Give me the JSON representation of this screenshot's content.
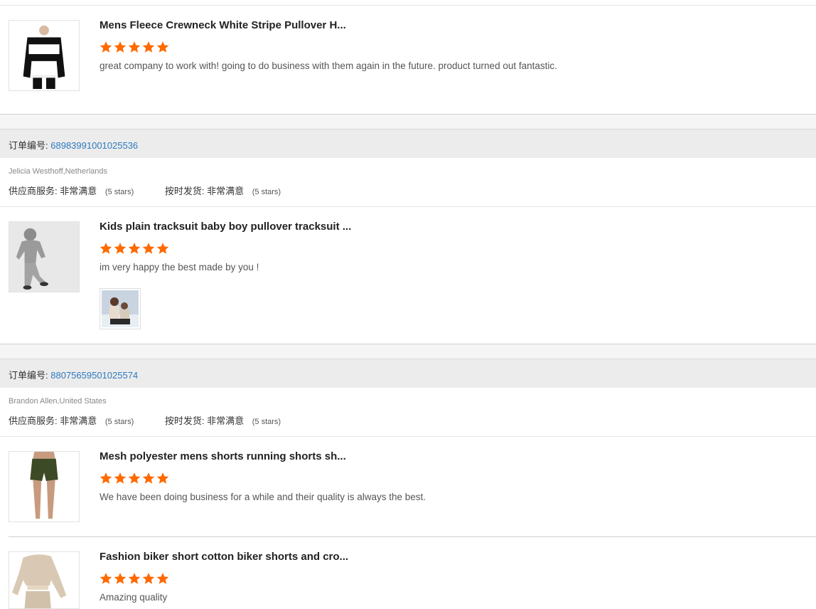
{
  "colors": {
    "accent_link": "#2e7bbf",
    "star": "#ff6a00",
    "order_bar_bg": "#ececec"
  },
  "orders": [
    {
      "items": [
        {
          "thumb_icon": "black-sweater-image",
          "title": "Mens Fleece Crewneck White Stripe Pullover H...",
          "stars": 5,
          "review": "great company to work with! going to do business with them again in the future. product turned out fantastic."
        }
      ]
    },
    {
      "order_label": "订单编号:",
      "order_number": "68983991001025536",
      "buyer": "Jelicia Westhoff,Netherlands",
      "supplier_service_label": "供应商服务:",
      "supplier_service_value": "非常满意",
      "supplier_service_stars": "(5 stars)",
      "delivery_label": "按时发货:",
      "delivery_value": "非常满意",
      "delivery_stars": "(5 stars)",
      "items": [
        {
          "thumb_icon": "kids-tracksuit-image",
          "title": "Kids plain tracksuit baby boy pullover tracksuit ...",
          "stars": 5,
          "review": "im very happy the best made by you !",
          "attachment_icon": "customer-photo-thumbnail"
        }
      ]
    },
    {
      "order_label": "订单编号:",
      "order_number": "88075659501025574",
      "buyer": "Brandon Allen,United States",
      "supplier_service_label": "供应商服务:",
      "supplier_service_value": "非常满意",
      "supplier_service_stars": "(5 stars)",
      "delivery_label": "按时发货:",
      "delivery_value": "非常满意",
      "delivery_stars": "(5 stars)",
      "items": [
        {
          "thumb_icon": "green-shorts-image",
          "title": "Mesh polyester mens shorts running shorts sh...",
          "stars": 5,
          "review": "We have been doing business for a while and their quality is always the best."
        },
        {
          "thumb_icon": "beige-crop-set-image",
          "title": "Fashion biker short cotton biker shorts and cro...",
          "stars": 5,
          "review": "Amazing quality"
        }
      ]
    }
  ]
}
